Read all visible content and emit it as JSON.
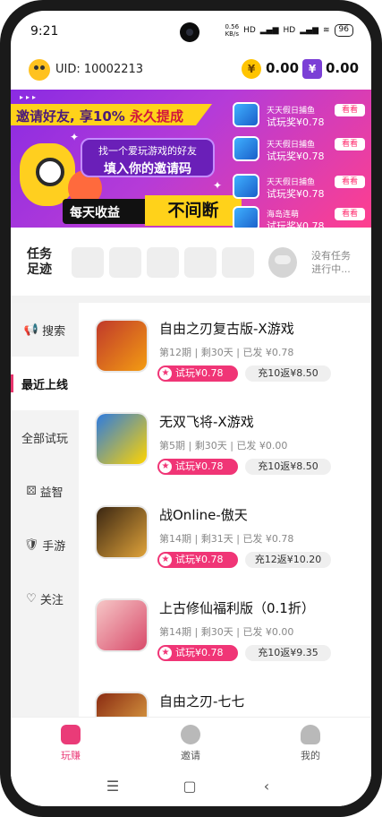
{
  "status_bar": {
    "time": "9:21",
    "net_speed": "0.56",
    "net_unit": "KB/s",
    "hd1": "HD",
    "hd2": "HD",
    "battery": "96"
  },
  "header": {
    "uid_label": "UID: 10002213",
    "coins": "0.00",
    "gems": "0.00",
    "coin_icon": "¥",
    "gem_icon": "¥"
  },
  "banner": {
    "headline_part1": "邀请好友, 享10% ",
    "headline_part2": "永久提成",
    "sub_line1": "找一个爱玩游戏的好友",
    "sub_line2": "填入你的邀请码",
    "pill_text": "每天收益",
    "pill_highlight": "不间断",
    "ticker": [
      {
        "line1": "天天假日捕鱼",
        "line2": "试玩奖¥0.78",
        "button": "看看"
      },
      {
        "line1": "天天假日捕鱼",
        "line2": "试玩奖¥0.78",
        "button": "看看"
      },
      {
        "line1": "天天假日捕鱼",
        "line2": "试玩奖¥0.78",
        "button": "看看"
      },
      {
        "line1": "海岛连萌",
        "line2": "试玩奖¥0.78",
        "button": "看看"
      }
    ]
  },
  "task_strip": {
    "title": "任务足迹",
    "empty_line1": "没有任务",
    "empty_line2": "进行中..."
  },
  "categories": [
    {
      "icon": "📢",
      "label": "搜索",
      "active": false
    },
    {
      "icon": "",
      "label": "最近上线",
      "active": true
    },
    {
      "icon": "",
      "label": "全部试玩",
      "active": false
    },
    {
      "icon": "⚄",
      "label": "益智",
      "active": false
    },
    {
      "icon": "🛡",
      "label": "手游",
      "active": false
    },
    {
      "icon": "♡",
      "label": "关注",
      "active": false
    }
  ],
  "games": [
    {
      "title": "自由之刃复古版-X游戏",
      "meta": "第12期 | 剩30天 | 已发 ¥0.78",
      "trial": "试玩¥0.78",
      "rebate": "充10返¥8.50",
      "icon_color": "#c0392b",
      "icon_color2": "#f39c12"
    },
    {
      "title": "无双飞将-X游戏",
      "meta": "第5期 | 剩30天 | 已发 ¥0.00",
      "trial": "试玩¥0.78",
      "rebate": "充10返¥8.50",
      "icon_color": "#2d7be0",
      "icon_color2": "#ffd400"
    },
    {
      "title": "战Online-傲天",
      "meta": "第14期 | 剩31天 | 已发 ¥0.78",
      "trial": "试玩¥0.78",
      "rebate": "充12返¥10.20",
      "icon_color": "#3a2612",
      "icon_color2": "#e0a33a"
    },
    {
      "title": "上古修仙福利版（0.1折）",
      "meta": "第14期 | 剩30天 | 已发 ¥0.00",
      "trial": "试玩¥0.78",
      "rebate": "充10返¥9.35",
      "icon_color": "#f6c7c7",
      "icon_color2": "#d84a6a"
    },
    {
      "title": "自由之刃-七七",
      "meta": "",
      "trial": "",
      "rebate": "",
      "icon_color": "#8a2b12",
      "icon_color2": "#e8b04a"
    }
  ],
  "bottom_nav": [
    {
      "label": "玩赚",
      "active": true
    },
    {
      "label": "邀请",
      "active": false
    },
    {
      "label": "我的",
      "active": false
    }
  ],
  "system_nav": {
    "menu": "☰",
    "home": "▢",
    "back": "‹"
  }
}
